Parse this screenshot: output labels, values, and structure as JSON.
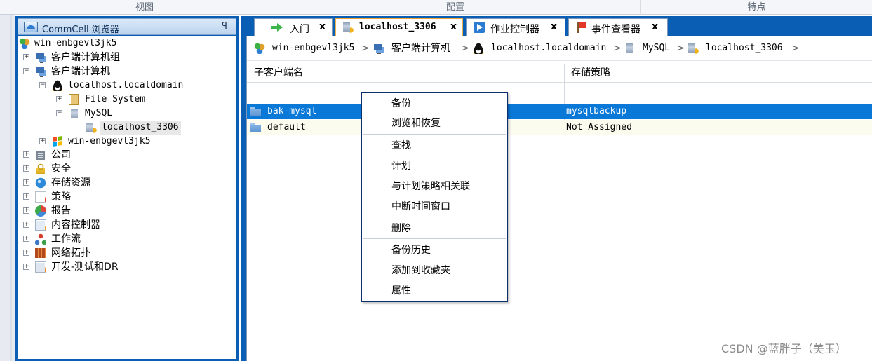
{
  "menubar": {
    "view": "视图",
    "config": "配置",
    "features": "特点"
  },
  "browser": {
    "title": "CommCell 浏览器",
    "pin": "ꟼ",
    "tree": [
      {
        "label": "win-enbgevl3jk5",
        "icon": "commcell-icon"
      },
      {
        "label": "客户端计算机组",
        "icon": "client-computer-group-icon"
      },
      {
        "label": "客户端计算机",
        "icon": "client-computers-icon"
      },
      {
        "label": "localhost.localdomain",
        "icon": "linux-icon"
      },
      {
        "label": "File System",
        "icon": "file-system-icon"
      },
      {
        "label": "MySQL",
        "icon": "mysql-icon"
      },
      {
        "label": "localhost_3306",
        "icon": "mysql-instance-icon"
      },
      {
        "label": "win-enbgevl3jk5",
        "icon": "windows-icon"
      },
      {
        "label": "公司",
        "icon": "company-icon"
      },
      {
        "label": "安全",
        "icon": "security-lock-icon"
      },
      {
        "label": "存储资源",
        "icon": "storage-globe-icon"
      },
      {
        "label": "策略",
        "icon": "policy-icon"
      },
      {
        "label": "报告",
        "icon": "report-pie-icon"
      },
      {
        "label": "内容控制器",
        "icon": "content-director-icon"
      },
      {
        "label": "工作流",
        "icon": "workflow-icon"
      },
      {
        "label": "网络拓扑",
        "icon": "network-topology-icon"
      },
      {
        "label": "开发-测试和DR",
        "icon": "dev-test-dr-icon"
      }
    ]
  },
  "tabs": [
    {
      "label": "入门",
      "close": "x",
      "icon": "green-arrow-icon"
    },
    {
      "label": "localhost_3306",
      "close": "x",
      "icon": "mysql-instance-icon"
    },
    {
      "label": "作业控制器",
      "close": "x",
      "icon": "play-icon"
    },
    {
      "label": "事件查看器",
      "close": "x",
      "icon": "flag-icon"
    }
  ],
  "breadcrumb": [
    {
      "label": "win-enbgevl3jk5",
      "icon": "commcell-icon"
    },
    {
      "label": "客户端计算机",
      "icon": "client-computers-icon"
    },
    {
      "label": "localhost.localdomain",
      "icon": "linux-icon"
    },
    {
      "label": "MySQL",
      "icon": "mysql-icon"
    },
    {
      "label": "localhost_3306",
      "icon": "mysql-instance-icon"
    }
  ],
  "breadcrumb_sep": ">",
  "table": {
    "columns": [
      "子客户端名",
      "存储策略"
    ],
    "rows": [
      {
        "name": "bak-mysql",
        "policy": "mysqlbackup",
        "selected": true
      },
      {
        "name": "default",
        "policy": "Not Assigned",
        "selected": false
      }
    ]
  },
  "context_menu": {
    "items": [
      "备份",
      "浏览和恢复",
      "查找",
      "计划",
      "与计划策略相关联",
      "中断时间窗口",
      "删除",
      "备份历史",
      "添加到收藏夹",
      "属性"
    ]
  },
  "watermark": "CSDN @蓝胖子（美玉）",
  "colors": {
    "accent": "#0a5fb4",
    "selection": "#0a78d7",
    "tab_highlight": "#f0a33a"
  }
}
